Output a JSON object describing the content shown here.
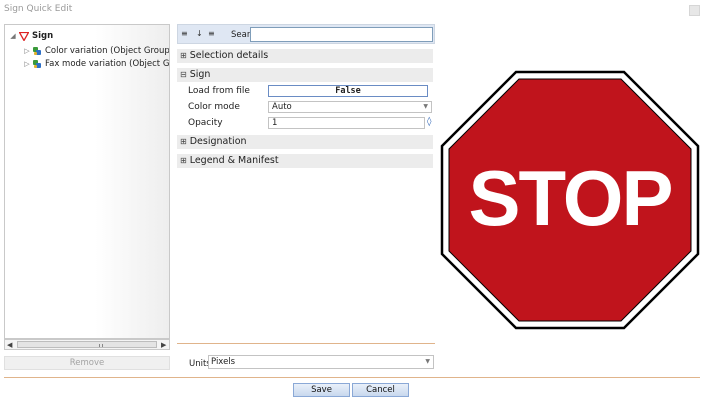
{
  "window": {
    "title": "Sign Quick Edit"
  },
  "tree": {
    "root": {
      "label": "Sign",
      "expander": "◢"
    },
    "children": [
      {
        "label": "Color variation (Object Group)",
        "expander": "▷"
      },
      {
        "label": "Fax mode variation (Object Group)",
        "expander": "▷"
      }
    ]
  },
  "left_panel": {
    "remove_label": "Remove"
  },
  "toolbar": {
    "categorized_icon": "≡",
    "sort_icon": "↓",
    "list_icon": "≡",
    "search_label": "Search:",
    "search_value": ""
  },
  "property_grid": {
    "categories": {
      "selection_details": {
        "label": "Selection details",
        "toggle": "⊞"
      },
      "sign": {
        "label": "Sign",
        "toggle": "⊟"
      },
      "designation": {
        "label": "Designation",
        "toggle": "⊞"
      },
      "legend": {
        "label": "Legend & Manifest",
        "toggle": "⊞"
      }
    },
    "properties": {
      "load_from_file": {
        "name": "Load from file",
        "value": "False"
      },
      "color_mode": {
        "name": "Color mode",
        "value": "Auto"
      },
      "opacity": {
        "name": "Opacity",
        "value": "1"
      }
    }
  },
  "units": {
    "label": "Units:",
    "value": "Pixels"
  },
  "actions": {
    "save_label": "Save",
    "cancel_label": "Cancel"
  },
  "preview": {
    "sign_text": "STOP",
    "sign_color": "#c0141c",
    "border_color": "#000000"
  },
  "colors": {
    "toolbar_bg": "#dfe7f3",
    "category_bg": "#ececec",
    "accent_line": "#e0b48b"
  }
}
